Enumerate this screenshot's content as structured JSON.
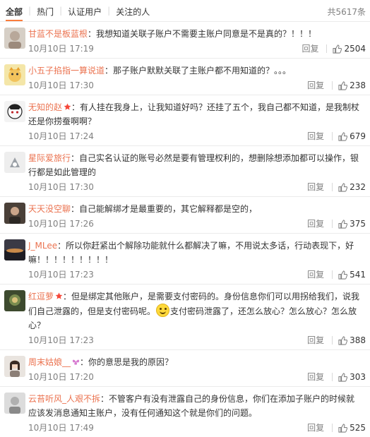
{
  "tabs": [
    {
      "label": "全部"
    },
    {
      "label": "热门"
    },
    {
      "label": "认证用户"
    },
    {
      "label": "关注的人"
    }
  ],
  "total": "共5617条",
  "reply_label": "回复",
  "comments": [
    {
      "user": "甘蓝不是板蓝根",
      "vip": false,
      "text": "：我想知道关联子账户不需要主账户同意是不是真的？！！！",
      "time": "10月10日 17:19",
      "likes": "2504",
      "avatar": "av-1"
    },
    {
      "user": "小五子掐指一算说道",
      "vip": false,
      "text": "：那子账户默默关联了主账户都不用知道的？。。。",
      "time": "10月10日 17:30",
      "likes": "238",
      "avatar": "av-2"
    },
    {
      "user": "无知的赵",
      "vip": true,
      "text": "：有人挂在我身上，让我知道好吗？还挂了五个，我自己都不知道，是我制杖还是你捞蚕啊啊？",
      "time": "10月10日 17:24",
      "likes": "679",
      "avatar": "av-3"
    },
    {
      "user": "星际爱旅行",
      "vip": false,
      "text": "：自己实名认证的账号必然是要有管理权利的，想删除想添加都可以操作，银行都是如此管理的",
      "time": "10月10日 17:30",
      "likes": "232",
      "avatar": "av-4"
    },
    {
      "user": "天天没空聊",
      "vip": false,
      "text": "：自己能解绑才是最重要的，其它解释都是空的，",
      "time": "10月10日 17:26",
      "likes": "375",
      "avatar": "av-5"
    },
    {
      "user": "J_MLee",
      "vip": false,
      "text": "：所以你赶紧出个解除功能就什么都解决了嘛，不用说太多话，行动表现下，好嘛！！！！！！！！！",
      "time": "10月10日 17:23",
      "likes": "541",
      "avatar": "av-6"
    },
    {
      "user": "红逗萝",
      "vip": true,
      "text_a": "：但是绑定其他账户，是需要支付密码的。身份信息你们可以用拐给我们，说我们自己泄露的，但是支付密码呢。",
      "text_b": "支付密码泄露了，还怎么放心？怎么放心？怎么放心？",
      "time": "10月10日 17:23",
      "likes": "388",
      "avatar": "av-7"
    },
    {
      "user": "周末姑娘__",
      "vip": false,
      "text": "：你的意思是我的原因？",
      "time": "10月10日 17:20",
      "likes": "303",
      "avatar": "av-8"
    },
    {
      "user": "云苔听风_人艰不拆",
      "vip": false,
      "text": "：不管客户有没有泄露自己的身份信息，你们在添加子账户的时候就应该发消息通知主账户，没有任何通知这个就是你们的问题。",
      "time": "10月10日 17:49",
      "likes": "525",
      "avatar": "av-9"
    }
  ]
}
